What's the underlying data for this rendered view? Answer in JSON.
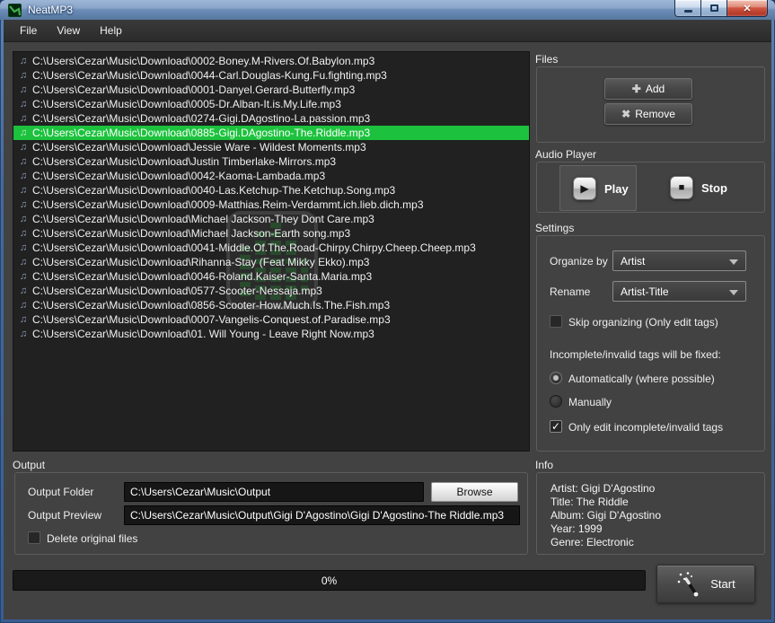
{
  "window": {
    "title": "NeatMP3"
  },
  "menu": {
    "items": [
      "File",
      "View",
      "Help"
    ]
  },
  "file_list": {
    "selected_index": 5,
    "items": [
      "C:\\Users\\Cezar\\Music\\Download\\0002-Boney.M-Rivers.Of.Babylon.mp3",
      "C:\\Users\\Cezar\\Music\\Download\\0044-Carl.Douglas-Kung.Fu.fighting.mp3",
      "C:\\Users\\Cezar\\Music\\Download\\0001-Danyel.Gerard-Butterfly.mp3",
      "C:\\Users\\Cezar\\Music\\Download\\0005-Dr.Alban-It.is.My.Life.mp3",
      "C:\\Users\\Cezar\\Music\\Download\\0274-Gigi.DAgostino-La.passion.mp3",
      "C:\\Users\\Cezar\\Music\\Download\\0885-Gigi.DAgostino-The.Riddle.mp3",
      "C:\\Users\\Cezar\\Music\\Download\\Jessie Ware - Wildest Moments.mp3",
      "C:\\Users\\Cezar\\Music\\Download\\Justin Timberlake-Mirrors.mp3",
      "C:\\Users\\Cezar\\Music\\Download\\0042-Kaoma-Lambada.mp3",
      "C:\\Users\\Cezar\\Music\\Download\\0040-Las.Ketchup-The.Ketchup.Song.mp3",
      "C:\\Users\\Cezar\\Music\\Download\\0009-Matthias.Reim-Verdammt.ich.lieb.dich.mp3",
      "C:\\Users\\Cezar\\Music\\Download\\Michael Jackson-They Dont Care.mp3",
      "C:\\Users\\Cezar\\Music\\Download\\Michael Jackson-Earth song.mp3",
      "C:\\Users\\Cezar\\Music\\Download\\0041-Middle.Of.The.Road-Chirpy.Chirpy.Cheep.Cheep.mp3",
      "C:\\Users\\Cezar\\Music\\Download\\Rihanna-Stay (Feat  Mikky Ekko).mp3",
      "C:\\Users\\Cezar\\Music\\Download\\0046-Roland.Kaiser-Santa.Maria.mp3",
      "C:\\Users\\Cezar\\Music\\Download\\0577-Scooter-Nessaja.mp3",
      "C:\\Users\\Cezar\\Music\\Download\\0856-Scooter-How.Much.Is.The.Fish.mp3",
      "C:\\Users\\Cezar\\Music\\Download\\0007-Vangelis-Conquest.of.Paradise.mp3",
      "C:\\Users\\Cezar\\Music\\Download\\01. Will Young - Leave Right Now.mp3"
    ]
  },
  "files_section": {
    "label": "Files",
    "add_label": "Add",
    "remove_label": "Remove"
  },
  "audio_player": {
    "label": "Audio Player",
    "play_label": "Play",
    "stop_label": "Stop"
  },
  "settings": {
    "label": "Settings",
    "organize_by_label": "Organize by",
    "organize_by_value": "Artist",
    "rename_label": "Rename",
    "rename_value": "Artist-Title",
    "skip_label": "Skip organizing (Only edit tags)",
    "tags_note": "Incomplete/invalid tags will be fixed:",
    "radio_auto_label": "Automatically (where possible)",
    "radio_manual_label": "Manually",
    "only_edit_label": "Only edit incomplete/invalid tags"
  },
  "output": {
    "label": "Output",
    "folder_label": "Output Folder",
    "folder_value": "C:\\Users\\Cezar\\Music\\Output",
    "browse_label": "Browse",
    "preview_label": "Output Preview",
    "preview_value": "C:\\Users\\Cezar\\Music\\Output\\Gigi D'Agostino\\Gigi D'Agostino-The Riddle.mp3",
    "delete_label": "Delete original files"
  },
  "info": {
    "label": "Info",
    "lines": [
      "Artist: Gigi D'Agostino",
      "Title: The Riddle",
      "Album: Gigi D'Agostino",
      "Year: 1999",
      "Genre: Electronic"
    ]
  },
  "footer": {
    "progress": "0%",
    "start_label": "Start"
  },
  "colors": {
    "selected_green": "#1cc23d",
    "frame_blue": "#3a5d90",
    "client_gray": "#424242"
  }
}
